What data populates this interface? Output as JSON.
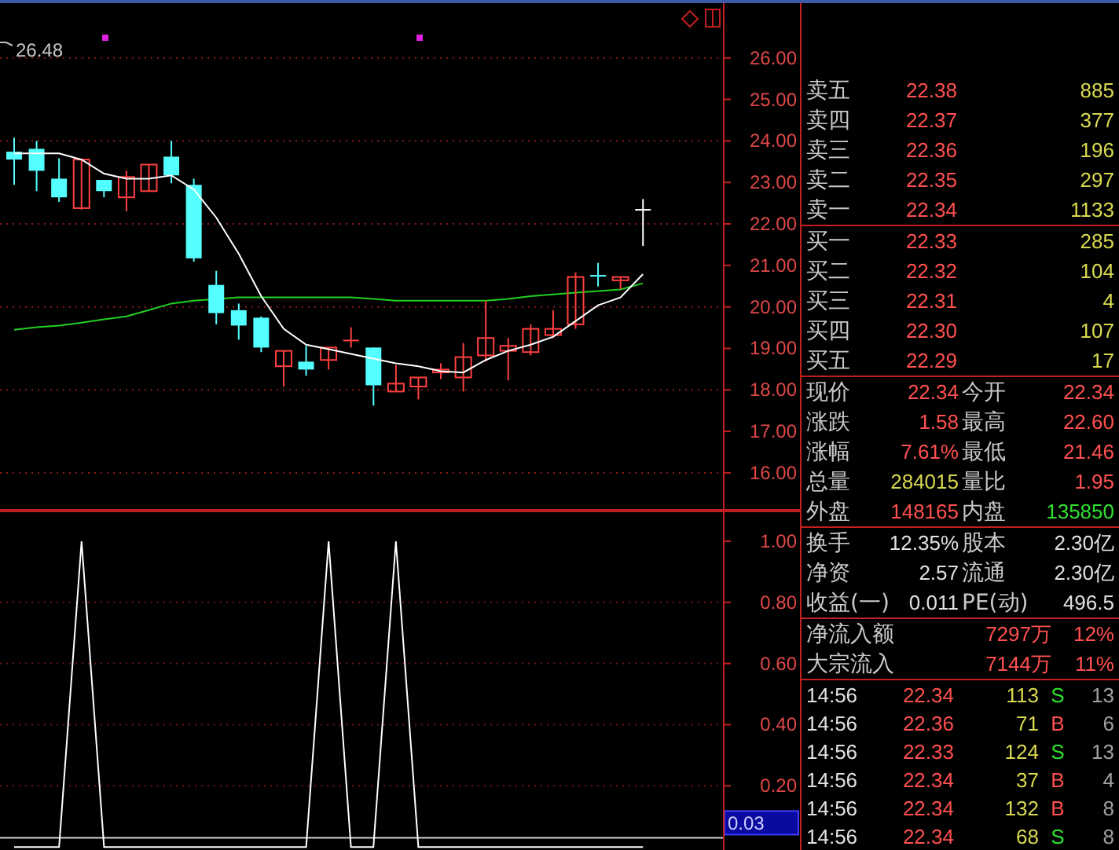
{
  "chart": {
    "high_label": "26.48",
    "chart_data": {
      "type": "candlestick",
      "ylim": [
        15.09,
        27.32
      ],
      "grid": true,
      "ohlc": [
        [
          23.74,
          24.08,
          22.94,
          23.55
        ],
        [
          23.81,
          24.0,
          22.79,
          23.28
        ],
        [
          23.09,
          23.58,
          22.53,
          22.64
        ],
        [
          22.38,
          23.55,
          22.34,
          23.55
        ],
        [
          23.06,
          23.06,
          22.64,
          22.79
        ],
        [
          22.64,
          23.28,
          22.3,
          23.13
        ],
        [
          22.79,
          23.43,
          22.79,
          23.43
        ],
        [
          23.62,
          24.0,
          22.98,
          23.17
        ],
        [
          22.94,
          23.09,
          21.09,
          21.17
        ],
        [
          20.53,
          20.87,
          19.58,
          19.85
        ],
        [
          19.92,
          20.08,
          19.21,
          19.55
        ],
        [
          19.74,
          19.77,
          18.91,
          19.02
        ],
        [
          18.57,
          18.94,
          18.08,
          18.94
        ],
        [
          18.68,
          19.06,
          18.34,
          18.49
        ],
        [
          18.72,
          19.02,
          18.49,
          19.02
        ],
        [
          19.17,
          19.51,
          19.02,
          19.19
        ],
        [
          19.02,
          19.02,
          17.62,
          18.11
        ],
        [
          17.96,
          18.6,
          17.96,
          18.15
        ],
        [
          18.08,
          18.3,
          17.77,
          18.3
        ],
        [
          18.42,
          18.64,
          18.26,
          18.49
        ],
        [
          18.3,
          19.13,
          17.96,
          18.79
        ],
        [
          18.83,
          20.15,
          18.68,
          19.25
        ],
        [
          18.94,
          19.25,
          18.23,
          19.06
        ],
        [
          18.91,
          19.58,
          18.83,
          19.47
        ],
        [
          19.32,
          19.92,
          19.25,
          19.47
        ],
        [
          19.58,
          20.83,
          19.47,
          20.72
        ],
        [
          20.75,
          21.06,
          20.49,
          20.74
        ],
        [
          20.64,
          20.72,
          20.42,
          20.72
        ],
        [
          22.34,
          22.6,
          21.47,
          22.34
        ]
      ],
      "yticks": [
        {
          "value": 26,
          "label": "26.00"
        },
        {
          "value": 25,
          "label": "25.00"
        },
        {
          "value": 24,
          "label": "24.00"
        },
        {
          "value": 23,
          "label": "23.00"
        },
        {
          "value": 22,
          "label": "22.00"
        },
        {
          "value": 21,
          "label": "21.00"
        },
        {
          "value": 20,
          "label": "20.00"
        },
        {
          "value": 19,
          "label": "19.00"
        },
        {
          "value": 18,
          "label": "18.00"
        },
        {
          "value": 17,
          "label": "17.00"
        },
        {
          "value": 16,
          "label": "16.00"
        }
      ],
      "series": [
        {
          "type": "line",
          "color": "#20d020",
          "values": [
            19.45,
            19.51,
            19.55,
            19.62,
            19.7,
            19.77,
            19.92,
            20.08,
            20.15,
            null,
            20.23,
            20.23,
            20.23,
            20.23,
            20.23,
            20.23,
            20.19,
            20.15,
            20.15,
            20.15,
            20.15,
            20.15,
            20.19,
            20.26,
            20.3,
            20.34,
            20.38,
            20.42,
            20.57
          ]
        },
        {
          "type": "line",
          "color": "#ffffff",
          "values": [
            23.7,
            23.7,
            23.7,
            23.55,
            23.21,
            23.09,
            23.09,
            23.17,
            22.83,
            22.15,
            21.28,
            20.26,
            19.47,
            19.09,
            18.98,
            18.87,
            18.75,
            18.64,
            18.57,
            18.45,
            18.42,
            18.72,
            18.94,
            19.09,
            19.28,
            19.66,
            20.04,
            20.23,
            20.79
          ]
        }
      ]
    }
  },
  "indicator": {
    "chart_data": {
      "type": "line",
      "ylim": [
        -0.01,
        1.1
      ],
      "grid": true,
      "ref_lines": [
        {
          "axis": "y",
          "value": 0.03,
          "label": "0.03"
        }
      ],
      "yticks": [
        {
          "value": 1,
          "label": "1.00"
        },
        {
          "value": 0.8,
          "label": "0.80"
        },
        {
          "value": 0.6,
          "label": "0.60"
        },
        {
          "value": 0.4,
          "label": "0.40"
        },
        {
          "value": 0.2,
          "label": "0.20"
        }
      ],
      "series": [
        {
          "color": "#ffffff",
          "values": [
            0,
            0,
            0,
            1,
            0,
            0,
            0,
            0,
            0,
            0,
            0,
            0,
            0,
            0,
            1,
            0,
            0,
            1,
            0,
            0,
            0,
            0,
            0,
            0,
            0,
            0,
            0,
            0,
            0
          ]
        }
      ]
    }
  },
  "order_book": {
    "asks": [
      {
        "label": "卖五",
        "price": "22.38",
        "volume": "885"
      },
      {
        "label": "卖四",
        "price": "22.37",
        "volume": "377"
      },
      {
        "label": "卖三",
        "price": "22.36",
        "volume": "196"
      },
      {
        "label": "卖二",
        "price": "22.35",
        "volume": "297"
      },
      {
        "label": "卖一",
        "price": "22.34",
        "volume": "1133"
      }
    ],
    "bids": [
      {
        "label": "买一",
        "price": "22.33",
        "volume": "285"
      },
      {
        "label": "买二",
        "price": "22.32",
        "volume": "104"
      },
      {
        "label": "买三",
        "price": "22.31",
        "volume": "4"
      },
      {
        "label": "买四",
        "price": "22.30",
        "volume": "107"
      },
      {
        "label": "买五",
        "price": "22.29",
        "volume": "17"
      }
    ]
  },
  "quote": [
    {
      "label": "现价",
      "value": "22.34",
      "color": "#ff5050"
    },
    {
      "label": "今开",
      "value": "22.34",
      "color": "#ff5050"
    },
    {
      "label": "涨跌",
      "value": "1.58",
      "color": "#ff5050"
    },
    {
      "label": "最高",
      "value": "22.60",
      "color": "#ff5050"
    },
    {
      "label": "涨幅",
      "value": "7.61%",
      "color": "#ff5050"
    },
    {
      "label": "最低",
      "value": "21.46",
      "color": "#ff5050"
    },
    {
      "label": "总量",
      "value": "284015",
      "color": "#d8d850"
    },
    {
      "label": "量比",
      "value": "1.95",
      "color": "#ff5050"
    },
    {
      "label": "外盘",
      "value": "148165",
      "color": "#ff5050"
    },
    {
      "label": "内盘",
      "value": "135850",
      "color": "#30e030"
    }
  ],
  "stats": [
    {
      "label": "换手",
      "value": "12.35%"
    },
    {
      "label": "股本",
      "value": "2.30亿"
    },
    {
      "label": "净资",
      "value": "2.57"
    },
    {
      "label": "流通",
      "value": "2.30亿"
    },
    {
      "label": "收益(一)",
      "value": "0.011"
    },
    {
      "label": "PE(动)",
      "value": "496.5"
    }
  ],
  "flows": [
    {
      "label": "净流入额",
      "amount": "7297万",
      "percent": "12%"
    },
    {
      "label": "大宗流入",
      "amount": "7144万",
      "percent": "11%"
    }
  ],
  "trades": [
    {
      "time": "14:56",
      "price": "22.34",
      "volume": "113",
      "side": "S",
      "kind": "sell",
      "count": "13"
    },
    {
      "time": "14:56",
      "price": "22.36",
      "volume": "71",
      "side": "B",
      "kind": "buy",
      "count": "6"
    },
    {
      "time": "14:56",
      "price": "22.33",
      "volume": "124",
      "side": "S",
      "kind": "sell",
      "count": "13"
    },
    {
      "time": "14:56",
      "price": "22.34",
      "volume": "37",
      "side": "B",
      "kind": "buy",
      "count": "4"
    },
    {
      "time": "14:56",
      "price": "22.34",
      "volume": "132",
      "side": "B",
      "kind": "buy",
      "count": "8"
    },
    {
      "time": "14:56",
      "price": "22.34",
      "volume": "68",
      "side": "S",
      "kind": "sell",
      "count": "8"
    }
  ]
}
